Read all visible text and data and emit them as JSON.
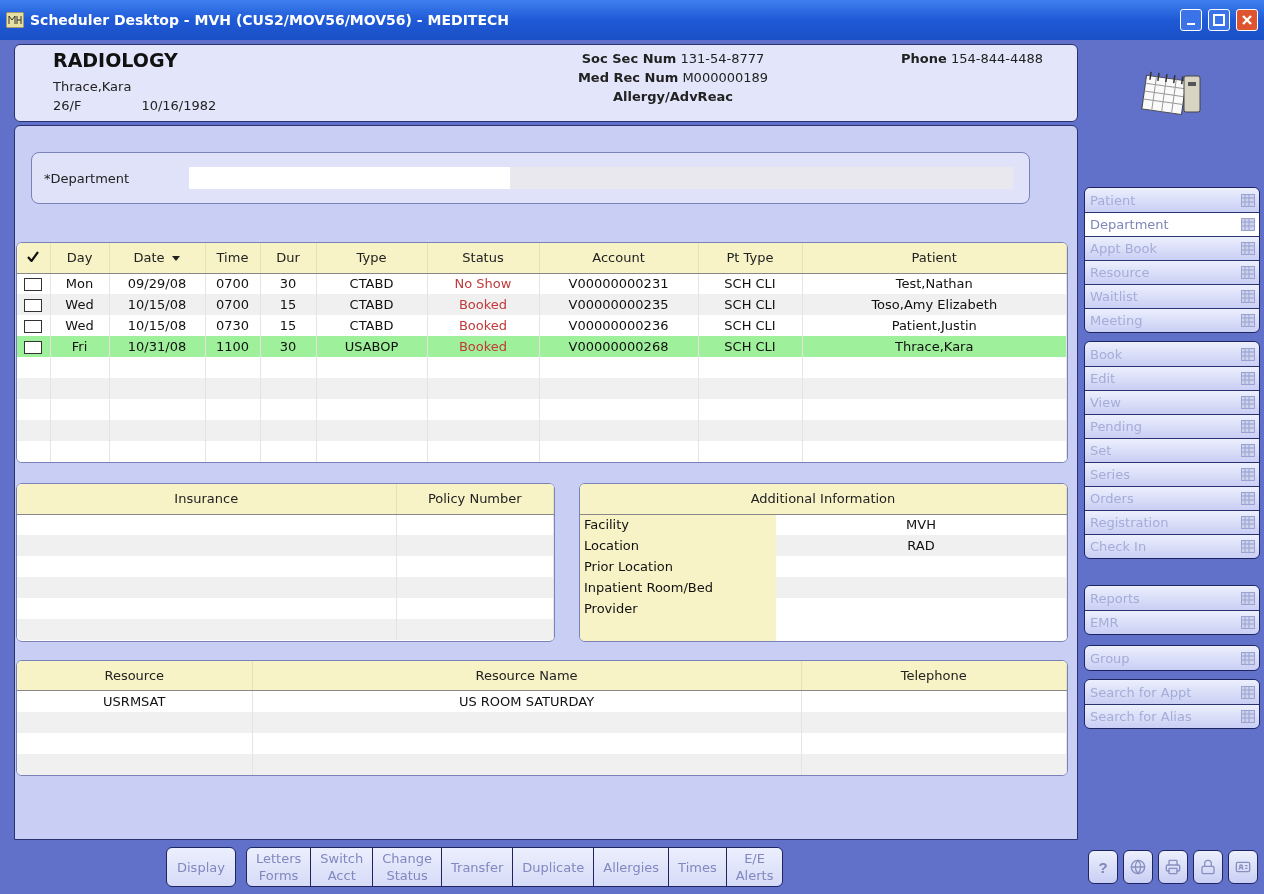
{
  "window": {
    "title": "Scheduler Desktop - MVH (CUS2/MOV56/MOV56) - MEDITECH"
  },
  "header": {
    "department": "RADIOLOGY",
    "patient_name": "Thrace,Kara",
    "age_sex": "26/F",
    "birth_date": "10/16/1982",
    "fields": [
      {
        "label": "Soc Sec Num",
        "value": "131-54-8777"
      },
      {
        "label": "Med Rec Num",
        "value": "M000000189"
      }
    ],
    "allergy": "Allergy/AdvReac",
    "phone": {
      "label": "Phone",
      "value": "154-844-4488"
    }
  },
  "department_field": {
    "label": "*Department"
  },
  "appointments": {
    "columns": [
      "Day",
      "Date",
      "Time",
      "Dur",
      "Type",
      "Status",
      "Account",
      "Pt Type",
      "Patient"
    ],
    "rows": [
      {
        "checked": false,
        "selected": false,
        "cells": [
          "Mon",
          "09/29/08",
          "0700",
          "30",
          "CTABD",
          "No Show",
          "V00000000231",
          "SCH CLI",
          "Test,Nathan"
        ]
      },
      {
        "checked": false,
        "selected": false,
        "cells": [
          "Wed",
          "10/15/08",
          "0700",
          "15",
          "CTABD",
          "Booked",
          "V00000000235",
          "SCH CLI",
          "Toso,Amy Elizabeth"
        ]
      },
      {
        "checked": false,
        "selected": false,
        "cells": [
          "Wed",
          "10/15/08",
          "0730",
          "15",
          "CTABD",
          "Booked",
          "V00000000236",
          "SCH CLI",
          "Patient,Justin"
        ]
      },
      {
        "checked": false,
        "selected": true,
        "cells": [
          "Fri",
          "10/31/08",
          "1100",
          "30",
          "USABOP",
          "Booked",
          "V00000000268",
          "SCH CLI",
          "Thrace,Kara"
        ]
      }
    ]
  },
  "insurance": {
    "columns": [
      "Insurance",
      "Policy Number"
    ]
  },
  "additional_info": {
    "title": "Additional Information",
    "rows": [
      {
        "label": "Facility",
        "value": "MVH"
      },
      {
        "label": "Location",
        "value": "RAD"
      },
      {
        "label": "Prior Location"
      },
      {
        "label": "Inpatient Room/Bed"
      },
      {
        "label": "Provider"
      }
    ]
  },
  "resources": {
    "columns": [
      "Resource",
      "Resource Name",
      "Telephone"
    ],
    "rows": [
      {
        "cells": [
          "USRMSAT",
          "US ROOM SATURDAY",
          ""
        ]
      }
    ]
  },
  "sidebar_groups": [
    [
      {
        "label": "Patient",
        "selected": false
      },
      {
        "label": "Department",
        "selected": true
      },
      {
        "label": "Appt Book",
        "selected": false
      },
      {
        "label": "Resource",
        "selected": false
      },
      {
        "label": "Waitlist",
        "selected": false
      },
      {
        "label": "Meeting",
        "selected": false
      }
    ],
    [
      {
        "label": "Book",
        "selected": false
      },
      {
        "label": "Edit",
        "selected": false
      },
      {
        "label": "View",
        "selected": false
      },
      {
        "label": "Pending",
        "selected": false
      },
      {
        "label": "Set",
        "selected": false
      },
      {
        "label": "Series",
        "selected": false
      },
      {
        "label": "Orders",
        "selected": false
      },
      {
        "label": "Registration",
        "selected": false
      },
      {
        "label": "Check In",
        "selected": false
      }
    ],
    [
      {
        "label": "Reports",
        "selected": false
      },
      {
        "label": "EMR",
        "selected": false
      }
    ],
    [
      {
        "label": "Group",
        "selected": false
      }
    ],
    [
      {
        "label": "Search for Appt",
        "selected": false
      },
      {
        "label": "Search for Alias",
        "selected": false
      }
    ]
  ],
  "toolbar": {
    "display": "Display",
    "buttons": [
      "Letters\nForms",
      "Switch\nAcct",
      "Change\nStatus",
      "Transfer",
      "Duplicate",
      "Allergies",
      "Times",
      "E/E\nAlerts"
    ]
  },
  "utility_buttons": [
    {
      "kind": "help",
      "label": "?"
    },
    {
      "kind": "globe"
    },
    {
      "kind": "printer"
    },
    {
      "kind": "lock"
    },
    {
      "kind": "card"
    }
  ]
}
